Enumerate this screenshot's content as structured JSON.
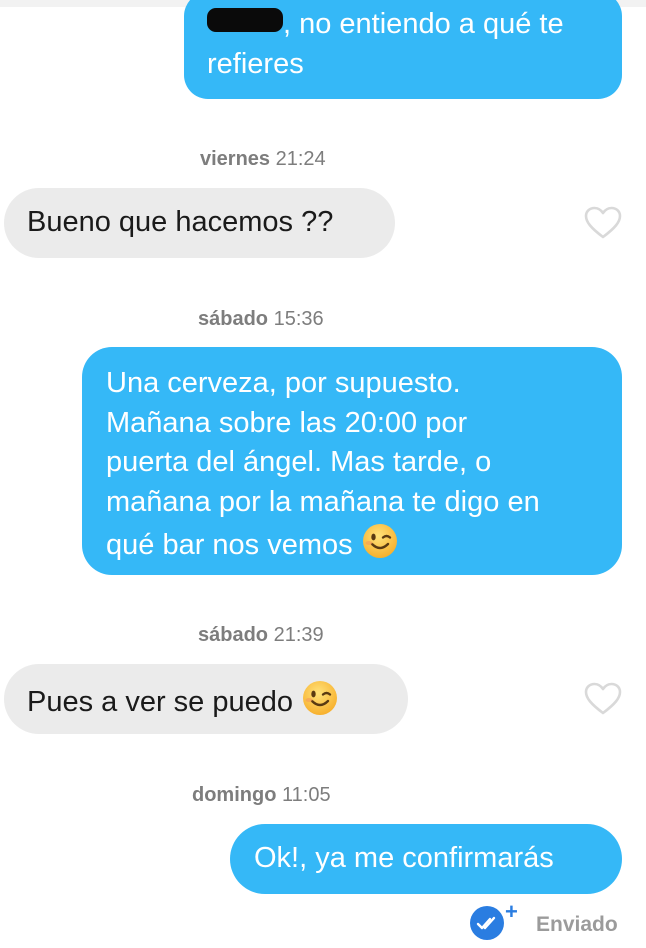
{
  "messages": [
    {
      "text_after_redaction": ", no entiendo a qué te",
      "line2": "refieres"
    },
    {
      "day": "viernes",
      "time": "21:24",
      "text": "Bueno que hacemos ??"
    },
    {
      "day": "sábado",
      "time": "15:36",
      "lines": [
        "Una cerveza, por supuesto.",
        "Mañana sobre las 20:00 por",
        "puerta del ángel. Mas tarde, o",
        "mañana por la mañana te digo en",
        "qué bar nos vemos"
      ]
    },
    {
      "day": "sábado",
      "time": "21:39",
      "text": "Pues a ver se puedo"
    },
    {
      "day": "domingo",
      "time": "11:05",
      "text": "Ok!, ya me confirmarás"
    }
  ],
  "status": {
    "label": "Enviado",
    "plus": "+"
  },
  "icons": {
    "like": "heart-outline-icon",
    "emoji": "winking-face-emoji",
    "delivered": "double-check-icon"
  },
  "colors": {
    "outgoing": "#35b8f7",
    "incoming": "#ebebeb",
    "delivered": "#2a7de1"
  }
}
